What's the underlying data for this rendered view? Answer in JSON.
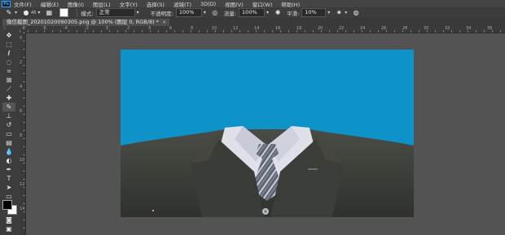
{
  "app": {
    "logo_text": "Ps"
  },
  "menu": [
    "文件(F)",
    "编辑(E)",
    "图像(I)",
    "图层(L)",
    "文字(Y)",
    "选择(S)",
    "滤镜(T)",
    "3D(D)",
    "视图(V)",
    "窗口(W)",
    "帮助(H)"
  ],
  "options": {
    "brush_size": "45",
    "mode_label": "模式:",
    "mode_value": "正常",
    "opacity_label": "不透明度:",
    "opacity_value": "100%",
    "flow_label": "流量:",
    "flow_value": "100%",
    "smoothing_label": "平滑:",
    "smoothing_value": "10%"
  },
  "document": {
    "tab_title": "微信截图_20201020090305.png @ 100% (图层 0, RGB/8) *",
    "close_icon": "×"
  },
  "rulers": {
    "top": [
      "-8",
      "-6",
      "-4",
      "-2",
      "0",
      "2",
      "4",
      "6",
      "8",
      "10",
      "12",
      "14",
      "16",
      "18",
      "20",
      "22",
      "24",
      "26",
      "28",
      "30",
      "32",
      "34",
      "36"
    ],
    "left": [
      "0",
      "2",
      "4",
      "6",
      "8",
      "10",
      "12",
      "14"
    ]
  },
  "colors": {
    "canvas_background": "#0e93c9",
    "suit": "#3d3f3a",
    "shirt": "#d9dbe6",
    "tie": "#6d7380",
    "ui_panel": "#3c3c3c",
    "ui_workspace": "#535353",
    "foreground_color": "#000000",
    "background_color": "#ffffff"
  },
  "tools": [
    "move-icon",
    "marquee-icon",
    "lasso-icon",
    "quick-select-icon",
    "crop-icon",
    "frame-icon",
    "eyedropper-icon",
    "healing-icon",
    "brush-icon",
    "stamp-icon",
    "history-brush-icon",
    "eraser-icon",
    "gradient-icon",
    "blur-icon",
    "dodge-icon",
    "pen-icon",
    "type-icon",
    "path-select-icon",
    "shape-icon",
    "hand-icon",
    "zoom-icon",
    "more-icon"
  ]
}
